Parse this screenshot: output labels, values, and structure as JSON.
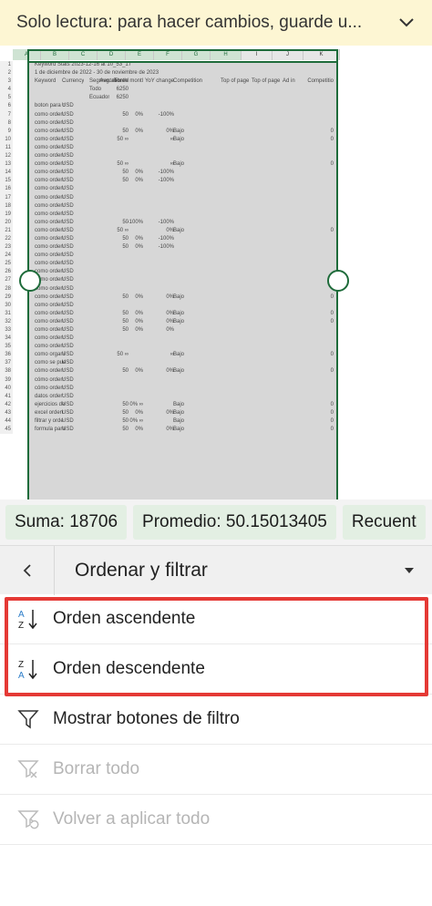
{
  "banner": {
    "text": "Solo lectura: para hacer cambios, guarde u..."
  },
  "sheet": {
    "columns": [
      "A",
      "B",
      "C",
      "D",
      "E",
      "F",
      "G",
      "H",
      "I",
      "J",
      "K"
    ],
    "rows": [
      {
        "n": "1",
        "a": "Keyword Stats 2023-12-16 at 10_53_17"
      },
      {
        "n": "2",
        "a": "1 de diciembre de 2022 - 30 de noviembre de 2023"
      },
      {
        "n": "3",
        "a": "Keyword",
        "b": "Currency",
        "c": "Segmentatio",
        "d": "Avg. monthl",
        "e": "Three montl",
        "f": "YoY change",
        "g": "Competition",
        "h": "Competitio",
        "i": "Top of page",
        "j": "Top of page",
        "k": "Ad in"
      },
      {
        "n": "4",
        "c": "Todo",
        "d": "6250"
      },
      {
        "n": "5",
        "c": "Ecuador",
        "d": "6250"
      },
      {
        "n": "6",
        "a": "boton para c",
        "b": "USD"
      },
      {
        "n": "7",
        "a": "como orden:",
        "b": "USD",
        "d": "50",
        "e": "0%",
        "f": "-100%"
      },
      {
        "n": "8",
        "a": "como orden:",
        "b": "USD"
      },
      {
        "n": "9",
        "a": "como orden:",
        "b": "USD",
        "d": "50",
        "e": "0%",
        "f": "0%",
        "g": "Bajo",
        "h": "0"
      },
      {
        "n": "10",
        "a": "como orden:",
        "b": "USD",
        "d": "50 ∞",
        "f": "∞",
        "g": "Bajo",
        "h": "0"
      },
      {
        "n": "11",
        "a": "como orden:",
        "b": "USD"
      },
      {
        "n": "12",
        "a": "como orden:",
        "b": "USD"
      },
      {
        "n": "13",
        "a": "como orden:",
        "b": "USD",
        "d": "50 ∞",
        "f": "∞",
        "g": "Bajo",
        "h": "0"
      },
      {
        "n": "14",
        "a": "como orden:",
        "b": "USD",
        "d": "50",
        "e": "0%",
        "f": "-100%"
      },
      {
        "n": "15",
        "a": "como orden:",
        "b": "USD",
        "d": "50",
        "e": "0%",
        "f": "-100%"
      },
      {
        "n": "16",
        "a": "como orden:",
        "b": "USD"
      },
      {
        "n": "17",
        "a": "como orden:",
        "b": "USD"
      },
      {
        "n": "18",
        "a": "como orden:",
        "b": "USD"
      },
      {
        "n": "19",
        "a": "como orden:",
        "b": "USD"
      },
      {
        "n": "20",
        "a": "como orden:",
        "b": "USD",
        "d": "50",
        "e": "-100%",
        "f": "-100%"
      },
      {
        "n": "21",
        "a": "como orden:",
        "b": "USD",
        "d": "50 ∞",
        "f": "0%",
        "g": "Bajo",
        "h": "0"
      },
      {
        "n": "22",
        "a": "como orden:",
        "b": "USD",
        "d": "50",
        "e": "0%",
        "f": "-100%"
      },
      {
        "n": "23",
        "a": "como orden:",
        "b": "USD",
        "d": "50",
        "e": "0%",
        "f": "-100%"
      },
      {
        "n": "24",
        "a": "como orden:",
        "b": "USD"
      },
      {
        "n": "25",
        "a": "como orden:",
        "b": "USD"
      },
      {
        "n": "26",
        "a": "como orden:",
        "b": "USD"
      },
      {
        "n": "27",
        "a": "como orden:",
        "b": "USD"
      },
      {
        "n": "28",
        "a": "como orden:",
        "b": "USD"
      },
      {
        "n": "29",
        "a": "como orden:",
        "b": "USD",
        "d": "50",
        "e": "0%",
        "f": "0%",
        "g": "Bajo",
        "h": "0"
      },
      {
        "n": "30",
        "a": "como orden:",
        "b": "USD"
      },
      {
        "n": "31",
        "a": "como orden:",
        "b": "USD",
        "d": "50",
        "e": "0%",
        "f": "0%",
        "g": "Bajo",
        "h": "0"
      },
      {
        "n": "32",
        "a": "como orden:",
        "b": "USD",
        "d": "50",
        "e": "0%",
        "f": "0%",
        "g": "Bajo",
        "h": "0"
      },
      {
        "n": "33",
        "a": "como orden:",
        "b": "USD",
        "d": "50",
        "e": "0%",
        "f": "0%"
      },
      {
        "n": "34",
        "a": "como orden:",
        "b": "USD"
      },
      {
        "n": "35",
        "a": "como orden:",
        "b": "USD"
      },
      {
        "n": "36",
        "a": "como organi",
        "b": "USD",
        "d": "50 ∞",
        "f": "∞",
        "g": "Bajo",
        "h": "0"
      },
      {
        "n": "37",
        "a": "como se pue",
        "b": "USD"
      },
      {
        "n": "38",
        "a": "cómo orden:",
        "b": "USD",
        "d": "50",
        "e": "0%",
        "f": "0%",
        "g": "Bajo",
        "h": "0"
      },
      {
        "n": "39",
        "a": "cómo orden:",
        "b": "USD"
      },
      {
        "n": "40",
        "a": "cómo orden:",
        "b": "USD"
      },
      {
        "n": "41",
        "a": "datos order:",
        "b": "USD"
      },
      {
        "n": "42",
        "a": "ejercicios de",
        "b": "USD",
        "d": "50",
        "e": "0% ∞",
        "g": "Bajo",
        "h": "0"
      },
      {
        "n": "43",
        "a": "excel orden:",
        "b": "USD",
        "d": "50",
        "e": "0%",
        "f": "0%",
        "g": "Bajo",
        "h": "0"
      },
      {
        "n": "44",
        "a": "filtrar y orde",
        "b": "USD",
        "d": "50",
        "e": "0% ∞",
        "g": "Bajo",
        "h": "0"
      },
      {
        "n": "45",
        "a": "formula para",
        "b": "USD",
        "d": "50",
        "e": "0%",
        "f": "0%",
        "g": "Bajo",
        "h": "0"
      }
    ]
  },
  "status": {
    "sum": "Suma: 18706",
    "avg": "Promedio: 50.15013405",
    "count": "Recuent"
  },
  "toolbar": {
    "title": "Ordenar y filtrar"
  },
  "menu": {
    "asc": "Orden ascendente",
    "desc": "Orden descendente",
    "show_filter": "Mostrar botones de filtro",
    "clear_all": "Borrar todo",
    "reapply": "Volver a aplicar todo"
  },
  "colors": {
    "accent": "#1e6b3a",
    "highlight": "#e53935",
    "banner": "#fdf6d3"
  }
}
